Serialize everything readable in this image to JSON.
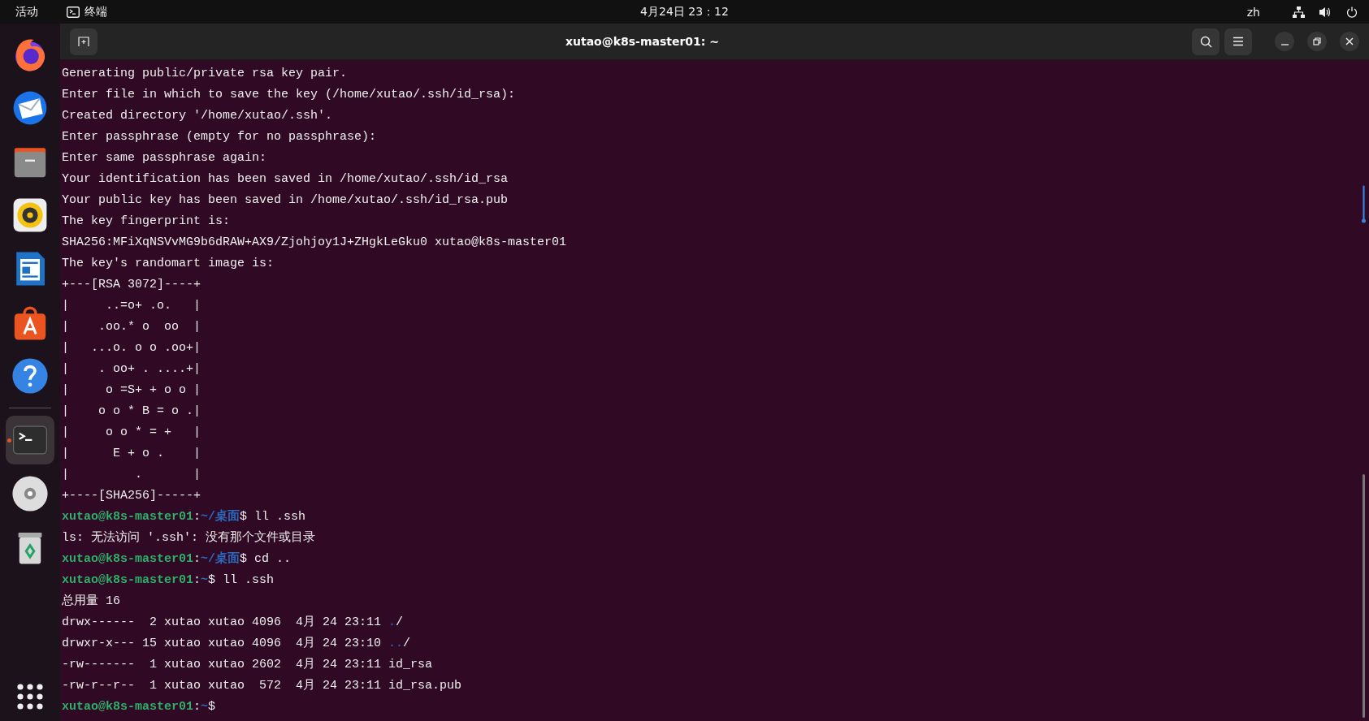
{
  "top_bar": {
    "activities": "活动",
    "app_name": "终端",
    "clock": "4月24日 23：12",
    "input_method": "zh"
  },
  "dock": [
    {
      "selected": false,
      "running": false
    },
    {
      "selected": false,
      "running": false
    },
    {
      "selected": false,
      "running": false
    },
    {
      "selected": false,
      "running": false
    },
    {
      "selected": false,
      "running": false
    },
    {
      "selected": false,
      "running": false
    },
    {
      "selected": false,
      "running": false
    },
    {
      "selected": true,
      "running": true
    },
    {
      "selected": false,
      "running": false
    },
    {
      "selected": false,
      "running": false
    }
  ],
  "window": {
    "title": "xutao@k8s-master01: ~"
  },
  "terminal": {
    "lines": [
      {
        "segments": [
          {
            "kind": "plain",
            "text": "Generating public/private rsa key pair."
          }
        ]
      },
      {
        "segments": [
          {
            "kind": "plain",
            "text": "Enter file in which to save the key (/home/xutao/.ssh/id_rsa):"
          }
        ]
      },
      {
        "segments": [
          {
            "kind": "plain",
            "text": "Created directory '/home/xutao/.ssh'."
          }
        ]
      },
      {
        "segments": [
          {
            "kind": "plain",
            "text": "Enter passphrase (empty for no passphrase):"
          }
        ]
      },
      {
        "segments": [
          {
            "kind": "plain",
            "text": "Enter same passphrase again:"
          }
        ]
      },
      {
        "segments": [
          {
            "kind": "plain",
            "text": "Your identification has been saved in /home/xutao/.ssh/id_rsa"
          }
        ]
      },
      {
        "segments": [
          {
            "kind": "plain",
            "text": "Your public key has been saved in /home/xutao/.ssh/id_rsa.pub"
          }
        ]
      },
      {
        "segments": [
          {
            "kind": "plain",
            "text": "The key fingerprint is:"
          }
        ]
      },
      {
        "segments": [
          {
            "kind": "plain",
            "text": "SHA256:MFiXqNSVvMG9b6dRAW+AX9/Zjohjoy1J+ZHgkLeGku0 xutao@k8s-master01"
          }
        ]
      },
      {
        "segments": [
          {
            "kind": "plain",
            "text": "The key's randomart image is:"
          }
        ]
      },
      {
        "segments": [
          {
            "kind": "plain",
            "text": "+---[RSA 3072]----+"
          }
        ]
      },
      {
        "segments": [
          {
            "kind": "plain",
            "text": "|     ..=o+ .o.   |"
          }
        ]
      },
      {
        "segments": [
          {
            "kind": "plain",
            "text": "|    .oo.* o  oo  |"
          }
        ]
      },
      {
        "segments": [
          {
            "kind": "plain",
            "text": "|   ...o. o o .oo+|"
          }
        ]
      },
      {
        "segments": [
          {
            "kind": "plain",
            "text": "|    . oo+ . ....+|"
          }
        ]
      },
      {
        "segments": [
          {
            "kind": "plain",
            "text": "|     o =S+ + o o |"
          }
        ]
      },
      {
        "segments": [
          {
            "kind": "plain",
            "text": "|    o o * B = o .|"
          }
        ]
      },
      {
        "segments": [
          {
            "kind": "plain",
            "text": "|     o o * = +   |"
          }
        ]
      },
      {
        "segments": [
          {
            "kind": "plain",
            "text": "|      E + o .    |"
          }
        ]
      },
      {
        "segments": [
          {
            "kind": "plain",
            "text": "|         .       |"
          }
        ]
      },
      {
        "segments": [
          {
            "kind": "plain",
            "text": "+----[SHA256]-----+"
          }
        ]
      },
      {
        "segments": [
          {
            "kind": "user",
            "text": "xutao@k8s-master01"
          },
          {
            "kind": "plain",
            "text": ":"
          },
          {
            "kind": "path",
            "text": "~/桌面"
          },
          {
            "kind": "plain",
            "text": "$ ll .ssh"
          }
        ]
      },
      {
        "segments": [
          {
            "kind": "plain",
            "text": "ls: 无法访问 '.ssh': 没有那个文件或目录"
          }
        ]
      },
      {
        "segments": [
          {
            "kind": "user",
            "text": "xutao@k8s-master01"
          },
          {
            "kind": "plain",
            "text": ":"
          },
          {
            "kind": "path",
            "text": "~/桌面"
          },
          {
            "kind": "plain",
            "text": "$ cd .."
          }
        ]
      },
      {
        "segments": [
          {
            "kind": "user",
            "text": "xutao@k8s-master01"
          },
          {
            "kind": "plain",
            "text": ":"
          },
          {
            "kind": "path",
            "text": "~"
          },
          {
            "kind": "plain",
            "text": "$ ll .ssh"
          }
        ]
      },
      {
        "segments": [
          {
            "kind": "plain",
            "text": "总用量 16"
          }
        ]
      },
      {
        "segments": [
          {
            "kind": "plain",
            "text": "drwx------  2 xutao xutao 4096  4月 24 23:11 "
          },
          {
            "kind": "dir",
            "text": "."
          },
          {
            "kind": "plain",
            "text": "/"
          }
        ]
      },
      {
        "segments": [
          {
            "kind": "plain",
            "text": "drwxr-x--- 15 xutao xutao 4096  4月 24 23:10 "
          },
          {
            "kind": "dir",
            "text": ".."
          },
          {
            "kind": "plain",
            "text": "/"
          }
        ]
      },
      {
        "segments": [
          {
            "kind": "plain",
            "text": "-rw-------  1 xutao xutao 2602  4月 24 23:11 id_rsa"
          }
        ]
      },
      {
        "segments": [
          {
            "kind": "plain",
            "text": "-rw-r--r--  1 xutao xutao  572  4月 24 23:11 id_rsa.pub"
          }
        ]
      },
      {
        "segments": [
          {
            "kind": "user",
            "text": "xutao@k8s-master01"
          },
          {
            "kind": "plain",
            "text": ":"
          },
          {
            "kind": "path",
            "text": "~"
          },
          {
            "kind": "plain",
            "text": "$"
          }
        ]
      }
    ]
  }
}
